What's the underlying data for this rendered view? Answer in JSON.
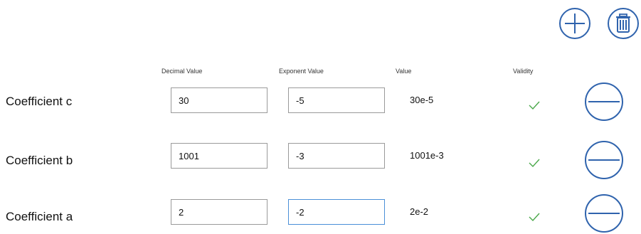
{
  "toolbar": {
    "add_icon": "plus-circle-icon",
    "delete_icon": "trash-circle-icon"
  },
  "columns": {
    "decimal": "Decimal Value",
    "exponent": "Exponent Value",
    "value": "Value",
    "validity": "Validity"
  },
  "rows": [
    {
      "label": "Coefficient c",
      "decimal": "30",
      "exponent": "-5",
      "value": "30e-5",
      "valid": true
    },
    {
      "label": "Coefficient b",
      "decimal": "1001",
      "exponent": "-3",
      "value": "1001e-3",
      "valid": true
    },
    {
      "label": "Coefficient a",
      "decimal": "2",
      "exponent": "-2",
      "value": "2e-2",
      "valid": true
    }
  ],
  "colors": {
    "icon_blue": "#2f63ad",
    "check_green": "#4aa84a",
    "focus_border": "#4a8fd8"
  }
}
